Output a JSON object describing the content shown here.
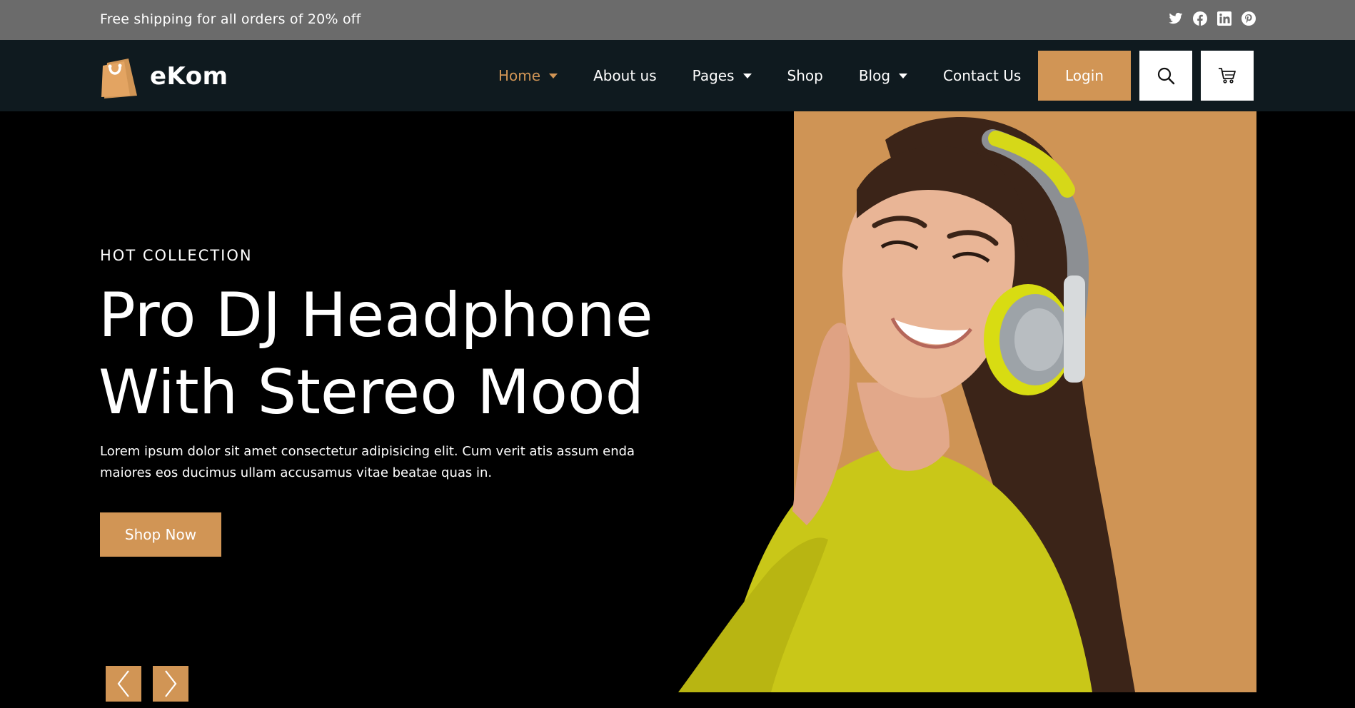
{
  "topbar": {
    "promo": "Free shipping for all orders of 20% off",
    "social": [
      "twitter-icon",
      "facebook-icon",
      "linkedin-icon",
      "pinterest-icon"
    ]
  },
  "brand": {
    "name": "eKom"
  },
  "nav": {
    "items": [
      {
        "label": "Home",
        "dropdown": true,
        "active": true
      },
      {
        "label": "About us",
        "dropdown": false
      },
      {
        "label": "Pages",
        "dropdown": true
      },
      {
        "label": "Shop",
        "dropdown": false
      },
      {
        "label": "Blog",
        "dropdown": true
      },
      {
        "label": "Contact Us",
        "dropdown": false
      }
    ],
    "login": "Login"
  },
  "hero": {
    "eyebrow": "HOT COLLECTION",
    "headline_line1": "Pro DJ Headphone",
    "headline_line2": "With Stereo Mood",
    "body": "Lorem ipsum dolor sit amet consectetur adipisicing elit. Cum verit atis assum enda maiores eos ducimus ullam accusamus vitae beatae quas in.",
    "cta": "Shop Now"
  },
  "colors": {
    "accent": "#d19555",
    "navbar": "#0f1a1f",
    "topbar": "#6b6b6b",
    "hero_bg": "#000000"
  }
}
